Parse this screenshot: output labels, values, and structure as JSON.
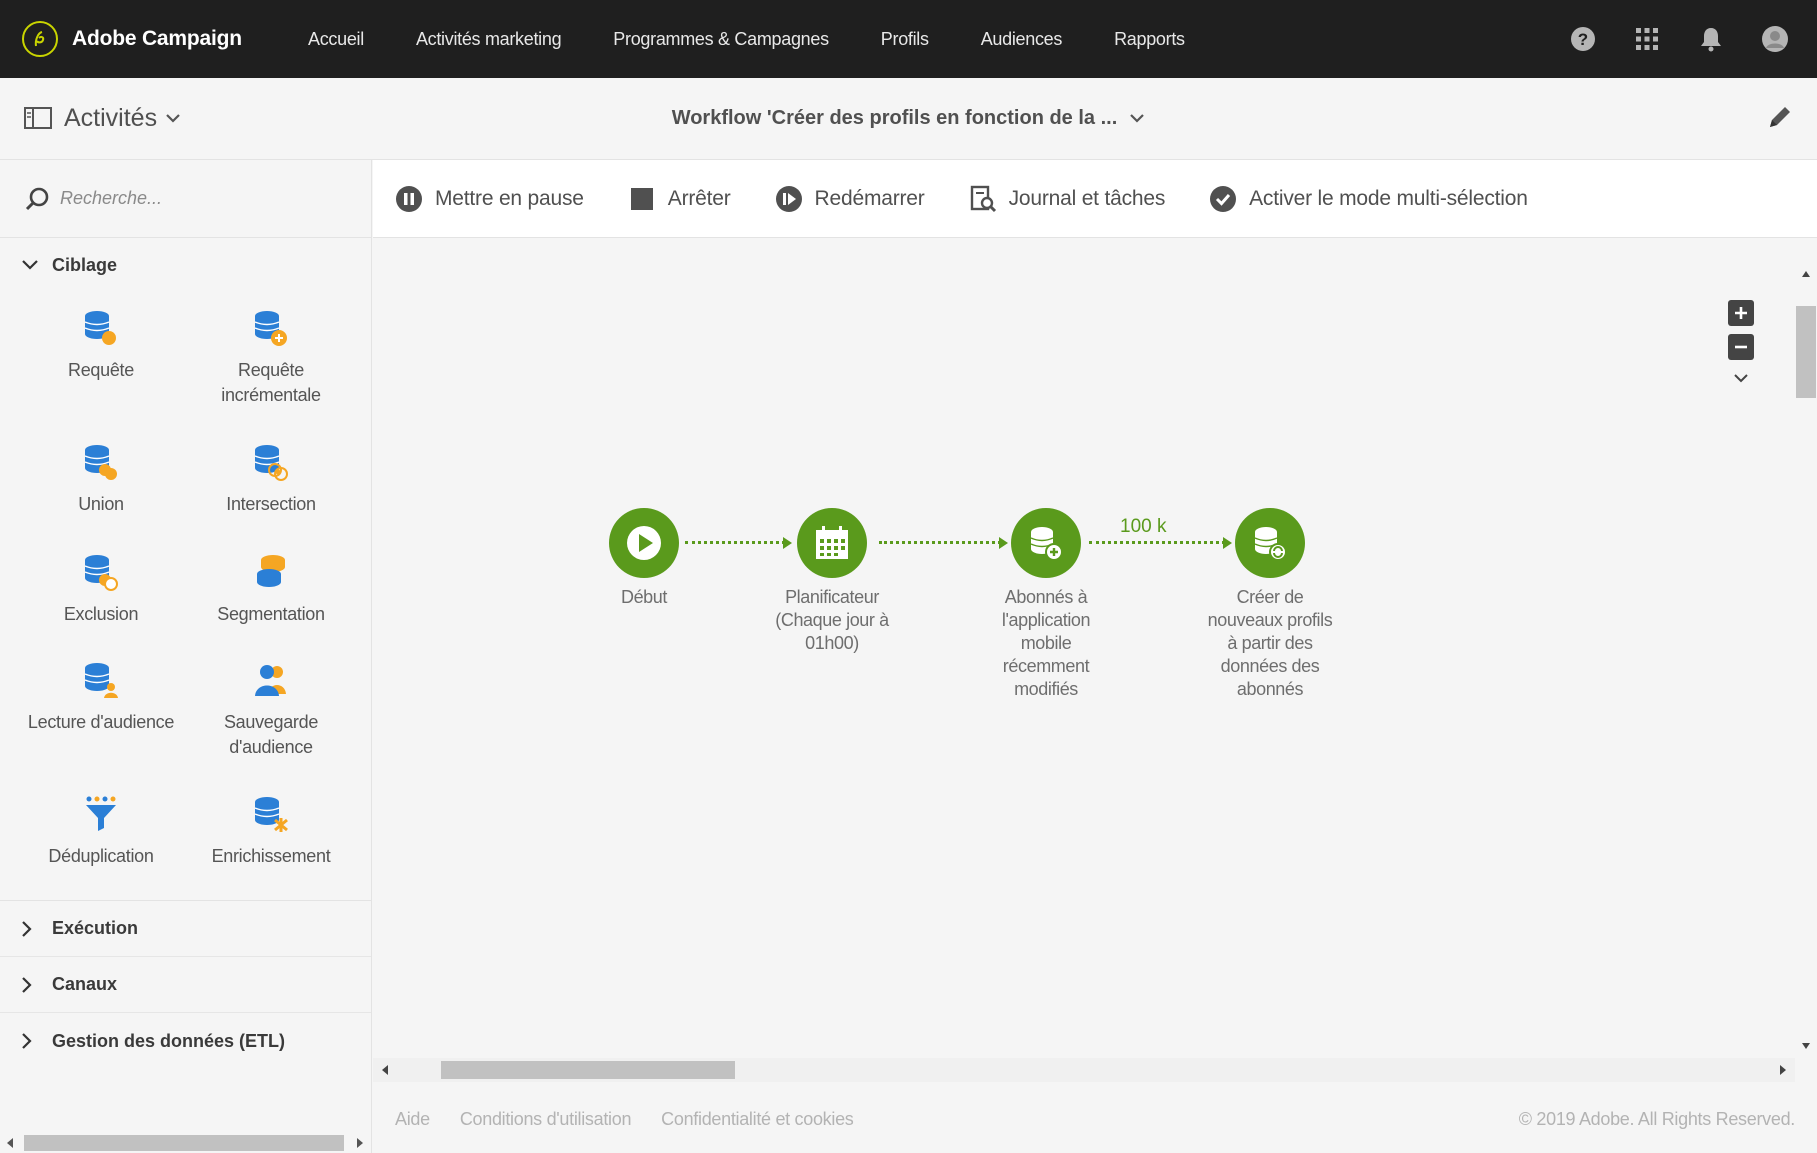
{
  "brand": {
    "name": "Adobe Campaign"
  },
  "nav": [
    "Accueil",
    "Activités marketing",
    "Programmes & Campagnes",
    "Profils",
    "Audiences",
    "Rapports"
  ],
  "header": {
    "activities_label": "Activités",
    "workflow_title": "Workflow 'Créer des profils en fonction de la ..."
  },
  "search": {
    "placeholder": "Recherche..."
  },
  "sidebar": {
    "sections": [
      {
        "label": "Ciblage",
        "expanded": true
      },
      {
        "label": "Exécution",
        "expanded": false
      },
      {
        "label": "Canaux",
        "expanded": false
      },
      {
        "label": "Gestion des données (ETL)",
        "expanded": false
      }
    ],
    "tiles": [
      "Requête",
      "Requête incrémentale",
      "Union",
      "Intersection",
      "Exclusion",
      "Segmentation",
      "Lecture d'audience",
      "Sauvegarde d'audience",
      "Déduplication",
      "Enrichissement"
    ]
  },
  "toolbar": {
    "pause": "Mettre en pause",
    "stop": "Arrêter",
    "restart": "Redémarrer",
    "journal": "Journal et tâches",
    "multiselect": "Activer le mode multi-sélection"
  },
  "workflow": {
    "nodes": [
      {
        "label": "Début",
        "icon": "play-icon"
      },
      {
        "label": "Planificateur (Chaque jour à 01h00)",
        "icon": "calendar-icon"
      },
      {
        "label": "Abonnés à l'application mobile récemment modifiés",
        "icon": "database-add-icon"
      },
      {
        "label": "Créer de nouveaux profils à partir des données des abonnés",
        "icon": "database-refresh-icon"
      }
    ],
    "edge_label": "100 k"
  },
  "footer": {
    "help": "Aide",
    "terms": "Conditions d'utilisation",
    "privacy": "Confidentialité et cookies",
    "copyright": "© 2019 Adobe. All Rights Reserved."
  },
  "colors": {
    "accent": "#5a9a1c",
    "db_blue": "#2b7fd6",
    "db_orange": "#f5a623",
    "topbar": "#1f1f1f"
  }
}
